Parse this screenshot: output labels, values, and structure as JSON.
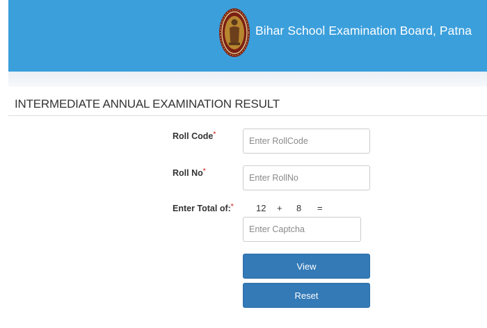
{
  "header": {
    "title": "Bihar School Examination Board, Patna",
    "logo_icon": "bseb-emblem-icon",
    "background": "#3b9fdc"
  },
  "page_title": "INTERMEDIATE ANNUAL EXAMINATION RESULT",
  "form": {
    "roll_code": {
      "label": "Roll Code",
      "required_mark": "*",
      "placeholder": "Enter RollCode",
      "value": ""
    },
    "roll_no": {
      "label": "Roll No",
      "required_mark": "*",
      "placeholder": "Enter RollNo",
      "value": ""
    },
    "captcha": {
      "label": "Enter Total of:",
      "required_mark": "*",
      "operand_a": "12",
      "operator": "+",
      "operand_b": "8",
      "equals": "=",
      "placeholder": "Enter Captcha",
      "value": ""
    },
    "view_label": "View",
    "reset_label": "Reset",
    "button_color": "#337ab7",
    "required_color": "#d9534f"
  }
}
